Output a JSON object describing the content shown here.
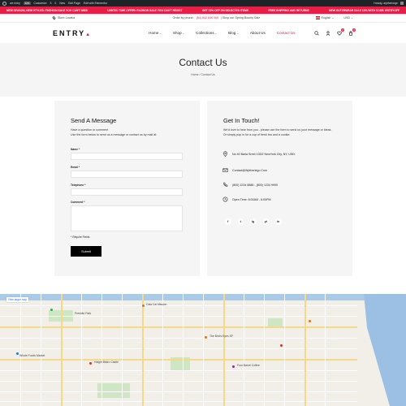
{
  "admin_bar": {
    "site": "we entry",
    "badge": "124",
    "items": [
      "Customize",
      "3",
      "0",
      "New",
      "Edit Page",
      "Edit with Elementor"
    ],
    "howdy": "Howdy, alpthemege"
  },
  "promo": {
    "items": [
      "NEW SEASON, NEW STYLES: FASHION SALE YOU CAN'T MISS",
      "LIMITED TIME OFFER: FASHION SALE YOU CAN'T RESIST",
      "GET 15% OFF ON SELECTED ITEMS",
      "FREE SHIPPING AND RETURNS",
      "NEW OUTERWEAR SALE 10% WITH CODE: ENTRYOFF"
    ]
  },
  "topbar": {
    "store_locator": "Store Locator",
    "order_text": "Order by phone:",
    "phone": "(84) 842 846 069",
    "spring": "| Shop our Spring Bounty Sale",
    "language": "English",
    "currency": "USD"
  },
  "header": {
    "logo": "ENTRY",
    "nav": [
      "Home",
      "Shop",
      "Collections",
      "Blog",
      "About Us",
      "Contact Us"
    ],
    "wishlist_count": "0",
    "cart_count": "0"
  },
  "hero": {
    "title": "Contact Us",
    "breadcrumb_home": "Home",
    "breadcrumb_sep": "/",
    "breadcrumb_current": "Contact Us"
  },
  "form": {
    "title": "Send A Message",
    "intro_1": "Have a question or comment",
    "intro_2": "Use the form below to send us a message or contact us by mail at:",
    "name_label": "Name *",
    "email_label": "Email *",
    "telephone_label": "Telephone *",
    "comment_label": "Comment *",
    "required_note": "* Require Fields",
    "submit_label": "Submit"
  },
  "contact": {
    "title": "Get In Touch!",
    "intro_1": "We'd love to hear from you - please use the form to send us your message or ideas.",
    "intro_2": "Or simply pop in for a cup of fresh tea and a cookie:",
    "address": "No 40 Baria Sreet 133/2 NewYork City, NY, USD.",
    "email": "Contact@Wptheriego.Com",
    "phone": "(800) 1234 8888 - (800) 1234 9999",
    "hours": "Open Time: 8:00AM - 6:00PM",
    "socials": [
      "f",
      "t",
      "ig",
      "yt",
      "in"
    ]
  },
  "map": {
    "view_larger": "View larger map",
    "labels": [
      "Cala Cal Mission",
      "Presidio Park",
      "Whole Foods Market",
      "The Bird's Eyes SF",
      "Four Barrel Coffee",
      "Haight Bistro Castle"
    ]
  },
  "colors": {
    "accent": "#e91e47",
    "dark": "#000000",
    "panel": "#f5f5f5"
  }
}
